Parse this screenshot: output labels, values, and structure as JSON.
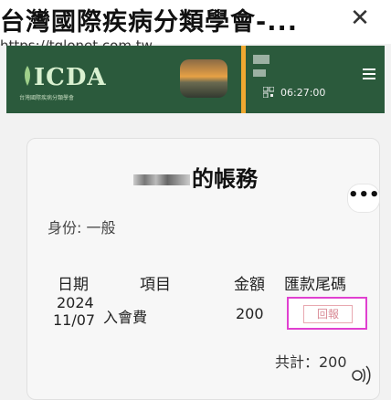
{
  "browser": {
    "page_title": "台灣國際疾病分類學會-...",
    "url": "https://tglonet.com.tw",
    "close_glyph": "✕"
  },
  "banner": {
    "logo_text": "ICDA",
    "logo_subtext": "台灣國際疾病分類學會",
    "time": "06:27:00",
    "menu_glyph": "≡"
  },
  "account": {
    "title_suffix": "的帳務",
    "more_glyph": "•••",
    "identity_label": "身份: 一般",
    "table": {
      "headers": [
        "日期",
        "項目",
        "金額",
        "匯款尾碼"
      ],
      "rows": [
        {
          "date_line1": "2024",
          "date_line2": "11/07",
          "item": "入會費",
          "amount": "200",
          "action_label": "回報"
        }
      ]
    },
    "total_label": "共計：200"
  },
  "colors": {
    "banner_green": "#2b5a3c",
    "accent_orange": "#f0a830",
    "highlight_magenta": "#e040d0",
    "reply_pink": "#d98a96"
  }
}
